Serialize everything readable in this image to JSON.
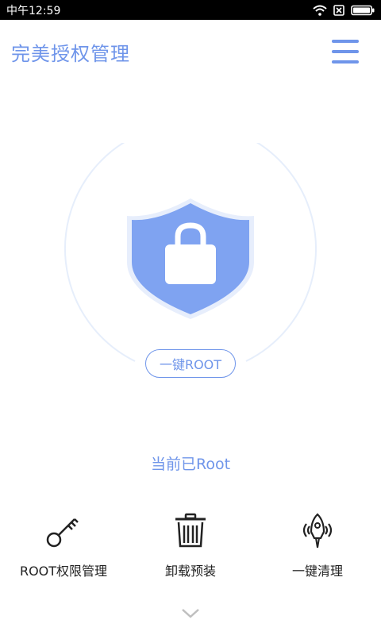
{
  "statusbar": {
    "time": "中午12:59",
    "icons": [
      "wifi-icon",
      "sim-none-icon",
      "battery-icon"
    ]
  },
  "header": {
    "title": "完美授权管理",
    "menu_icon": "hamburger-menu-icon"
  },
  "shield": {
    "icon": "shield-lock-icon",
    "button_label": "一键ROOT"
  },
  "status": {
    "text": "当前已Root"
  },
  "actions": [
    {
      "label": "ROOT权限管理",
      "icon": "key-icon"
    },
    {
      "label": "卸载预装",
      "icon": "trash-icon"
    },
    {
      "label": "一键清理",
      "icon": "rocket-clean-icon"
    }
  ],
  "footer": {
    "expand_icon": "chevron-down-icon"
  },
  "colors": {
    "accent": "#6f95ea",
    "shield_fill": "#7fa3f1",
    "status_bar": "#000000",
    "ring": "#e6eefb"
  }
}
